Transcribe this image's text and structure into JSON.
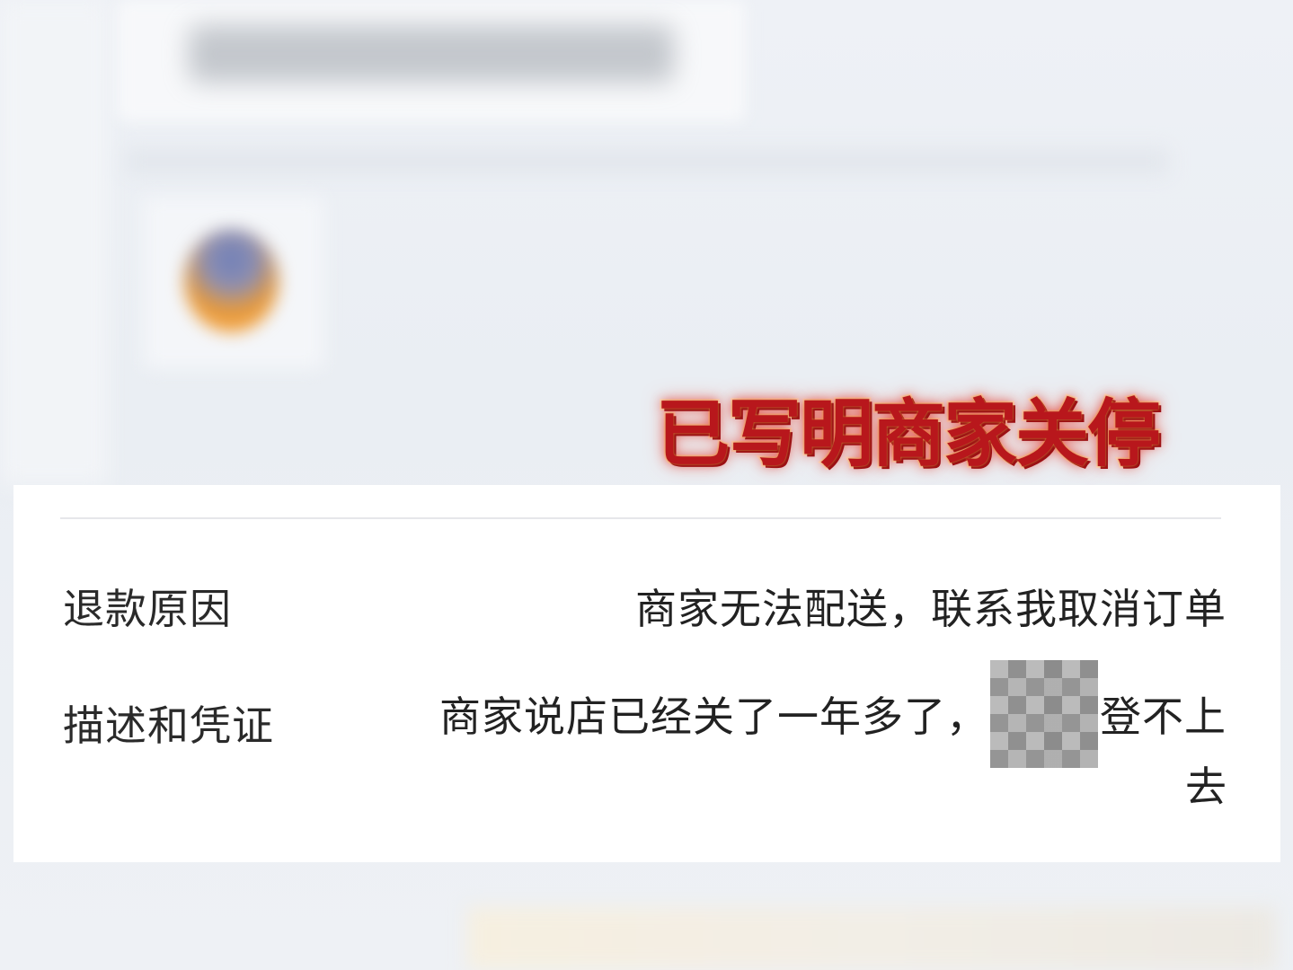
{
  "caption": "已写明商家关停",
  "details": {
    "rows": [
      {
        "label": "退款原因",
        "value": "商家无法配送，联系我取消订单"
      },
      {
        "label": "描述和凭证",
        "value_before": "商家说店已经关了一年多了，",
        "value_after": "登不上",
        "value_tail": "去"
      }
    ]
  }
}
